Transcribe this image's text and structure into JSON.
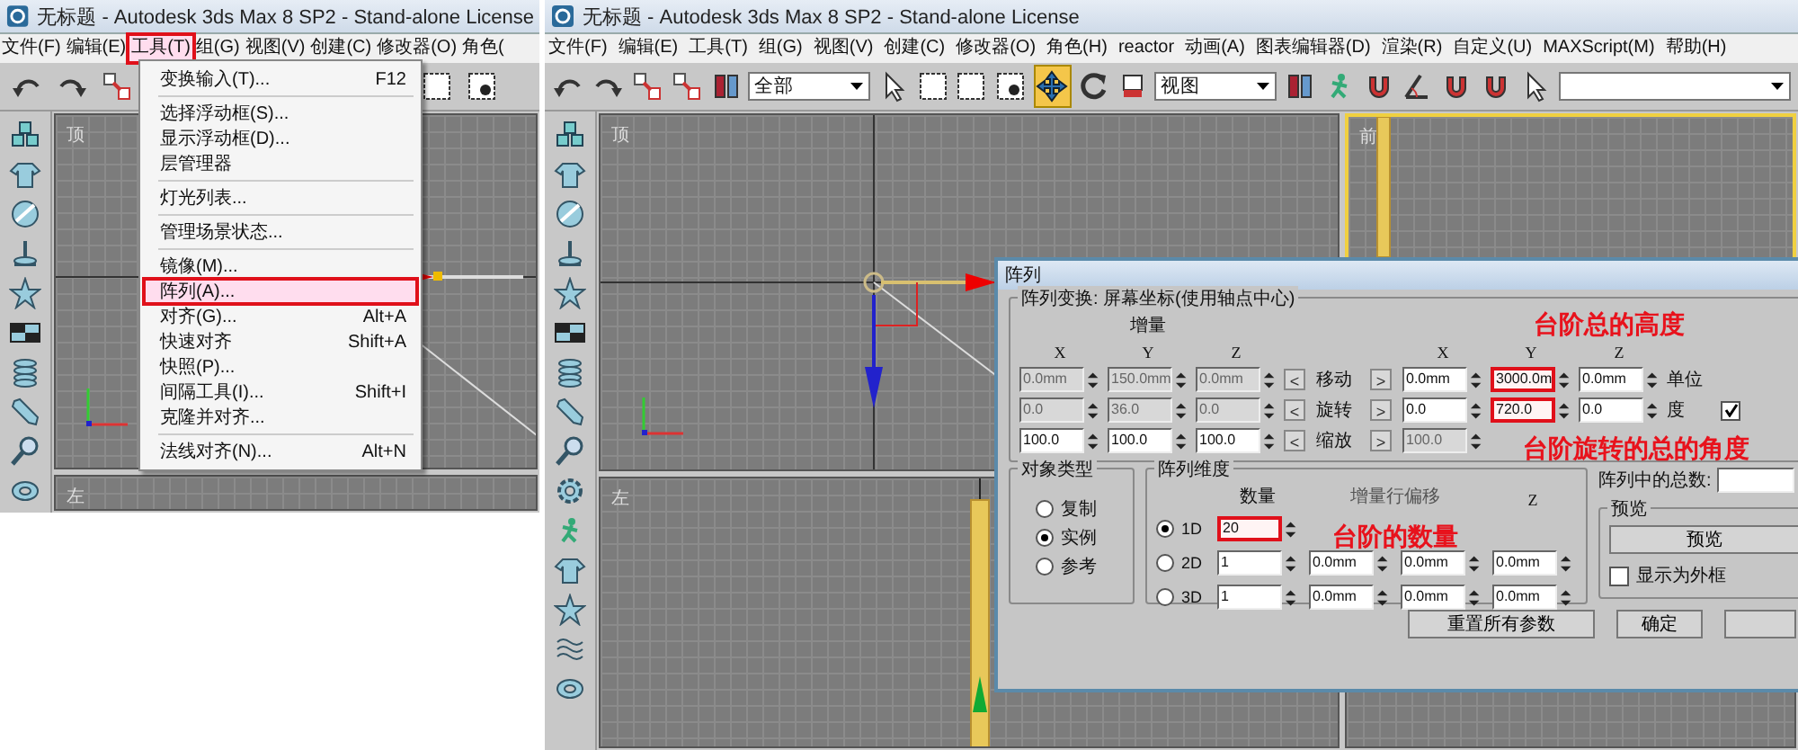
{
  "left_window": {
    "title": "无标题 - Autodesk 3ds Max 8 SP2  - Stand-alone License",
    "menu_bar": [
      {
        "label": "文件(F)",
        "highlighted": false
      },
      {
        "label": "编辑(E)",
        "highlighted": false
      },
      {
        "label": "工具(T)",
        "highlighted": true
      },
      {
        "label": "组(G)",
        "highlighted": false
      },
      {
        "label": "视图(V)",
        "highlighted": false
      },
      {
        "label": "创建(C)",
        "highlighted": false
      },
      {
        "label": "修改器(O)",
        "highlighted": false
      },
      {
        "label": "角色(",
        "highlighted": false
      }
    ],
    "viewports": [
      {
        "label": "顶"
      },
      {
        "label": "左"
      }
    ],
    "tools_menu": [
      {
        "kind": "item",
        "label": "变换输入(T)...",
        "shortcut": "F12",
        "highlighted": false
      },
      {
        "kind": "separator"
      },
      {
        "kind": "item",
        "label": "选择浮动框(S)...",
        "highlighted": false
      },
      {
        "kind": "item",
        "label": "显示浮动框(D)...",
        "highlighted": false
      },
      {
        "kind": "item",
        "label": "层管理器",
        "highlighted": false
      },
      {
        "kind": "separator"
      },
      {
        "kind": "item",
        "label": "灯光列表...",
        "highlighted": false
      },
      {
        "kind": "separator"
      },
      {
        "kind": "item",
        "label": "管理场景状态...",
        "highlighted": false
      },
      {
        "kind": "separator"
      },
      {
        "kind": "item",
        "label": "镜像(M)...",
        "highlighted": false
      },
      {
        "kind": "item",
        "label": "阵列(A)...",
        "highlighted": true
      },
      {
        "kind": "item",
        "label": "对齐(G)...",
        "shortcut": "Alt+A",
        "highlighted": false
      },
      {
        "kind": "item",
        "label": "快速对齐",
        "shortcut": "Shift+A",
        "highlighted": false
      },
      {
        "kind": "item",
        "label": "快照(P)...",
        "highlighted": false
      },
      {
        "kind": "item",
        "label": "间隔工具(I)...",
        "shortcut": "Shift+I",
        "highlighted": false
      },
      {
        "kind": "item",
        "label": "克隆并对齐...",
        "highlighted": false
      },
      {
        "kind": "separator"
      },
      {
        "kind": "item",
        "label": "法线对齐(N)...",
        "shortcut": "Alt+N",
        "highlighted": false
      }
    ]
  },
  "right_window": {
    "title": "无标题 - Autodesk 3ds Max 8 SP2  - Stand-alone License",
    "menu_bar": [
      "文件(F)",
      "编辑(E)",
      "工具(T)",
      "组(G)",
      "视图(V)",
      "创建(C)",
      "修改器(O)",
      "角色(H)",
      "reactor",
      "动画(A)",
      "图表编辑器(D)",
      "渲染(R)",
      "自定义(U)",
      "MAXScript(M)",
      "帮助(H)"
    ],
    "toolbar": {
      "selection_filter": "全部",
      "coordinate_system": "视图",
      "move_tool_active": true
    },
    "viewports": [
      {
        "label": "顶",
        "active": false
      },
      {
        "label": "前",
        "active": true
      },
      {
        "label": "左",
        "active": false
      }
    ],
    "array_dialog": {
      "title": "阵列",
      "transform_group": {
        "title": "阵列变换: 屏幕坐标(使用轴点中心)",
        "increment_header": "增量",
        "increment_axes": [
          "X",
          "Y",
          "Z"
        ],
        "total_axes": [
          "X",
          "Y",
          "Z"
        ],
        "left_button": "<",
        "right_button": ">",
        "rows": [
          {
            "label": "移动",
            "increment": [
              {
                "value": "0.0mm",
                "disabled": true
              },
              {
                "value": "150.0mm",
                "disabled": true
              },
              {
                "value": "0.0mm",
                "disabled": true
              }
            ],
            "totals": [
              {
                "value": "0.0mm",
                "disabled": false,
                "highlighted": false
              },
              {
                "value": "3000.0m",
                "disabled": false,
                "highlighted": true
              },
              {
                "value": "0.0mm",
                "disabled": false,
                "highlighted": false
              }
            ],
            "unit": "单位"
          },
          {
            "label": "旋转",
            "increment": [
              {
                "value": "0.0",
                "disabled": true
              },
              {
                "value": "36.0",
                "disabled": true
              },
              {
                "value": "0.0",
                "disabled": true
              }
            ],
            "totals": [
              {
                "value": "0.0",
                "disabled": false,
                "highlighted": false
              },
              {
                "value": "720.0",
                "disabled": false,
                "highlighted": true
              },
              {
                "value": "0.0",
                "disabled": false,
                "highlighted": false
              }
            ],
            "unit": "度",
            "checked": true
          },
          {
            "label": "缩放",
            "increment": [
              {
                "value": "100.0",
                "disabled": false
              },
              {
                "value": "100.0",
                "disabled": false
              },
              {
                "value": "100.0",
                "disabled": false
              }
            ],
            "totals": [
              {
                "value": "100.0",
                "disabled": true,
                "highlighted": false
              }
            ]
          }
        ]
      },
      "object_type": {
        "title": "对象类型",
        "options": [
          {
            "label": "复制",
            "selected": false
          },
          {
            "label": "实例",
            "selected": true
          },
          {
            "label": "参考",
            "selected": false
          }
        ]
      },
      "dimensions": {
        "title": "阵列维度",
        "count_header": "数量",
        "offset_header": "增量行偏移",
        "z_header": "Z",
        "rows": [
          {
            "label": "1D",
            "selected": true,
            "count": "20",
            "highlighted": true
          },
          {
            "label": "2D",
            "selected": false,
            "count": "1",
            "highlighted": false,
            "offsets": [
              "0.0mm",
              "0.0mm",
              "0.0mm"
            ]
          },
          {
            "label": "3D",
            "selected": false,
            "count": "1",
            "highlighted": false,
            "offsets": [
              "0.0mm",
              "0.0mm",
              "0.0mm"
            ]
          }
        ]
      },
      "total_label": "阵列中的总数:",
      "preview": {
        "title": "预览",
        "button": "预览",
        "outline_checkbox": {
          "label": "显示为外框",
          "checked": false
        }
      },
      "reset_button": "重置所有参数",
      "ok_button": "确定",
      "annotations": [
        "台阶总的高度",
        "台阶旋转的总的角度",
        "台阶的数量"
      ]
    }
  }
}
